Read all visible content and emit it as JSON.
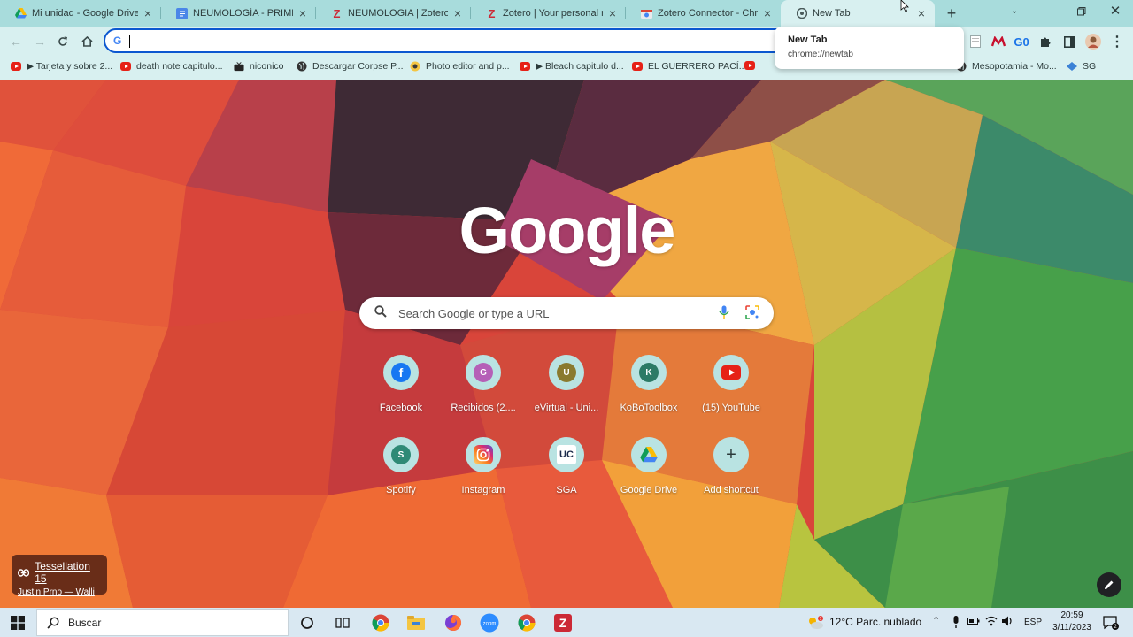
{
  "tabs": [
    {
      "title": "Mi unidad - Google Drive",
      "icon": "google-drive-icon"
    },
    {
      "title": "NEUMOLOGÍA - PRIMER C",
      "icon": "google-docs-icon"
    },
    {
      "title": "NEUMOLOGIA | Zotero",
      "icon": "zotero-icon"
    },
    {
      "title": "Zotero | Your personal res",
      "icon": "zotero-icon"
    },
    {
      "title": "Zotero Connector - Chrom",
      "icon": "chrome-web-store-icon"
    },
    {
      "title": "New Tab",
      "icon": "chrome-icon"
    }
  ],
  "tooltip": {
    "title": "New Tab",
    "url": "chrome://newtab"
  },
  "omnibox": {
    "value": ""
  },
  "bookmarks": [
    {
      "label": "▶ Tarjeta y sobre 2...",
      "icon": "youtube-icon"
    },
    {
      "label": "death note capitulo...",
      "icon": "youtube-icon"
    },
    {
      "label": "niconico",
      "icon": "tv-icon"
    },
    {
      "label": "Descargar Corpse P...",
      "icon": "globe-icon"
    },
    {
      "label": "Photo editor and p...",
      "icon": "photo-editor-icon"
    },
    {
      "label": "▶ Bleach capitulo d...",
      "icon": "youtube-icon"
    },
    {
      "label": "EL GUERRERO PACÍ...",
      "icon": "youtube-icon"
    },
    {
      "label": "Mesopotamia - Mo...",
      "icon": "globe-icon"
    },
    {
      "label": "SG",
      "icon": "sg-icon"
    }
  ],
  "ntp": {
    "logo": "Google",
    "search_placeholder": "Search Google or type a URL",
    "shortcuts": [
      {
        "label": "Facebook",
        "letter": "f",
        "color": "#1877f2"
      },
      {
        "label": "Recibidos (2....",
        "letter": "G",
        "color": "#b55fb7"
      },
      {
        "label": "eVirtual - Uni...",
        "letter": "U",
        "color": "#8a7a2e"
      },
      {
        "label": "KoBoToolbox",
        "letter": "K",
        "color": "#2c7a66"
      },
      {
        "label": "(15) YouTube",
        "letter": "",
        "color": "#e62117"
      },
      {
        "label": "Spotify",
        "letter": "S",
        "color": "#2f8a76"
      },
      {
        "label": "Instagram",
        "letter": "",
        "color": "#d6249f"
      },
      {
        "label": "SGA",
        "letter": "UC",
        "color": "#1b2a4a"
      },
      {
        "label": "Google Drive",
        "letter": "",
        "color": "#34a853"
      },
      {
        "label": "Add shortcut",
        "letter": "+",
        "color": "#b9e3e2"
      }
    ],
    "attribution": {
      "title": "Tessellation 15",
      "author": "Justin Prno — Walli"
    }
  },
  "taskbar": {
    "search_label": "Buscar",
    "weather": "12°C  Parc. nublado",
    "language": "ESP",
    "time": "20:59",
    "date": "3/11/2023"
  }
}
